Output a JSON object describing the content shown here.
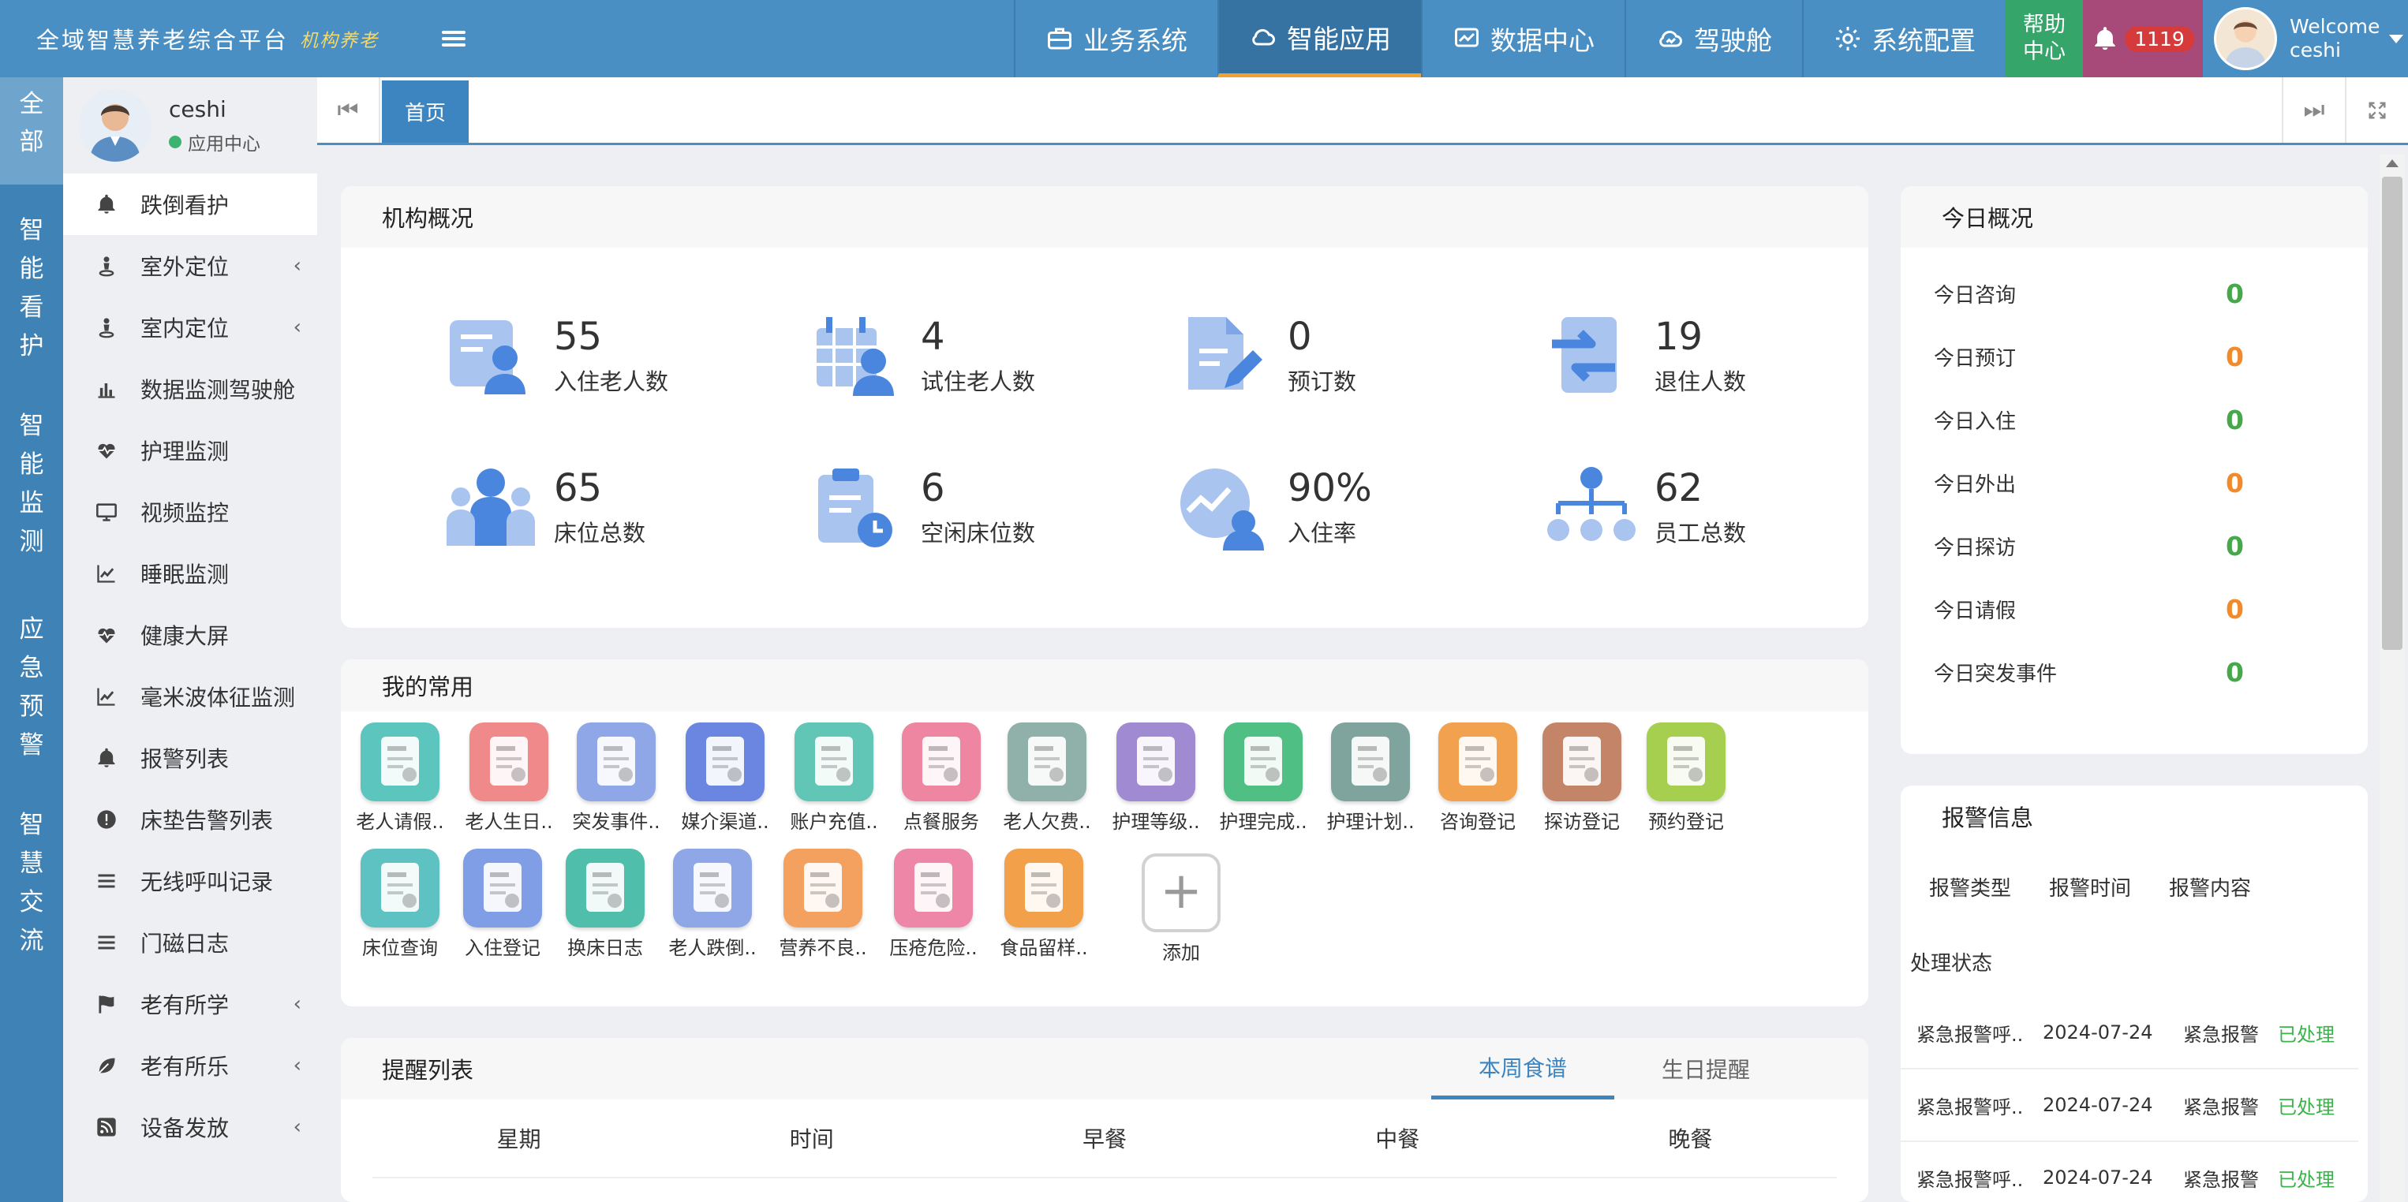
{
  "header": {
    "title": "全域智慧养老综合平台",
    "subtitle": "机构养老",
    "nav": [
      {
        "label": "业务系统",
        "icon": "briefcase-icon"
      },
      {
        "label": "智能应用",
        "icon": "cloud-icon"
      },
      {
        "label": "数据中心",
        "icon": "monitor-chart-icon"
      },
      {
        "label": "驾驶舱",
        "icon": "cloud-icon"
      },
      {
        "label": "系统配置",
        "icon": "gear-icon"
      }
    ],
    "active_nav": "智能应用",
    "help_label": "帮助中心",
    "notifications": "1119",
    "welcome": "Welcome",
    "username": "ceshi"
  },
  "categories": [
    {
      "label": "全部"
    },
    {
      "label": "智能看护"
    },
    {
      "label": "智能监测"
    },
    {
      "label": "应急预警"
    },
    {
      "label": "智慧交流"
    }
  ],
  "sidebar": {
    "user_name": "ceshi",
    "user_role": "应用中心",
    "items": [
      {
        "label": "跌倒看护",
        "icon": "bell-icon"
      },
      {
        "label": "室外定位",
        "icon": "person-pin-icon",
        "has_children": true
      },
      {
        "label": "室内定位",
        "icon": "person-pin-icon",
        "has_children": true
      },
      {
        "label": "数据监测驾驶舱",
        "icon": "bar-chart-icon"
      },
      {
        "label": "护理监测",
        "icon": "heartbeat-icon"
      },
      {
        "label": "视频监控",
        "icon": "monitor-icon"
      },
      {
        "label": "睡眠监测",
        "icon": "line-chart-icon"
      },
      {
        "label": "健康大屏",
        "icon": "heartbeat-icon"
      },
      {
        "label": "毫米波体征监测",
        "icon": "line-chart-icon"
      },
      {
        "label": "报警列表",
        "icon": "bell-icon"
      },
      {
        "label": "床垫告警列表",
        "icon": "alert-circle-icon"
      },
      {
        "label": "无线呼叫记录",
        "icon": "list-icon"
      },
      {
        "label": "门磁日志",
        "icon": "list-icon"
      },
      {
        "label": "老有所学",
        "icon": "flag-icon",
        "has_children": true
      },
      {
        "label": "老有所乐",
        "icon": "leaf-icon",
        "has_children": true
      },
      {
        "label": "设备发放",
        "icon": "rss-icon",
        "has_children": true
      }
    ]
  },
  "tabs": {
    "home_label": "首页"
  },
  "overview": {
    "title": "机构概况",
    "stats": [
      {
        "value": "55",
        "label": "入住老人数",
        "icon": "resident-card-icon"
      },
      {
        "value": "4",
        "label": "试住老人数",
        "icon": "calendar-person-icon"
      },
      {
        "value": "0",
        "label": "预订数",
        "icon": "document-edit-icon"
      },
      {
        "value": "19",
        "label": "退住人数",
        "icon": "exchange-arrows-icon"
      },
      {
        "value": "65",
        "label": "床位总数",
        "icon": "group-icon"
      },
      {
        "value": "6",
        "label": "空闲床位数",
        "icon": "clipboard-clock-icon"
      },
      {
        "value": "90%",
        "label": "入住率",
        "icon": "trend-person-icon"
      },
      {
        "value": "62",
        "label": "员工总数",
        "icon": "org-chart-icon"
      }
    ]
  },
  "today": {
    "title": "今日概况",
    "rows": [
      {
        "label": "今日咨询",
        "value": "0",
        "color": "#46a84a"
      },
      {
        "label": "今日预订",
        "value": "0",
        "color": "#f08a2a"
      },
      {
        "label": "今日入住",
        "value": "0",
        "color": "#46a84a"
      },
      {
        "label": "今日外出",
        "value": "0",
        "color": "#f08a2a"
      },
      {
        "label": "今日探访",
        "value": "0",
        "color": "#46a84a"
      },
      {
        "label": "今日请假",
        "value": "0",
        "color": "#f08a2a"
      },
      {
        "label": "今日突发事件",
        "value": "0",
        "color": "#46a84a"
      }
    ]
  },
  "favorites": {
    "title": "我的常用",
    "items": [
      {
        "label": "老人请假..",
        "color": "#5cc6be",
        "icon": "leave-icon"
      },
      {
        "label": "老人生日..",
        "color": "#f08a8a",
        "icon": "birthday-cake-icon"
      },
      {
        "label": "突发事件..",
        "color": "#8fa7e6",
        "icon": "event-form-icon"
      },
      {
        "label": "媒介渠道..",
        "color": "#6b86e0",
        "icon": "growth-chart-icon"
      },
      {
        "label": "账户充值..",
        "color": "#62c6b6",
        "icon": "person-money-icon"
      },
      {
        "label": "点餐服务",
        "color": "#ee86a2",
        "icon": "dish-icon"
      },
      {
        "label": "老人欠费..",
        "color": "#8fb1aa",
        "icon": "bill-icon"
      },
      {
        "label": "护理等级..",
        "color": "#a08ad2",
        "icon": "nurse-icon"
      },
      {
        "label": "护理完成..",
        "color": "#4fbf84",
        "icon": "checklist-icon"
      },
      {
        "label": "护理计划..",
        "color": "#7fa39d",
        "icon": "plan-clock-icon"
      },
      {
        "label": "咨询登记",
        "color": "#f2a24e",
        "icon": "id-card-icon"
      },
      {
        "label": "探访登记",
        "color": "#c48468",
        "icon": "visit-doc-icon"
      },
      {
        "label": "预约登记",
        "color": "#a7cf4f",
        "icon": "reserve-icon"
      },
      {
        "label": "床位查询",
        "color": "#5fc2c2",
        "icon": "bed-search-icon"
      },
      {
        "label": "入住登记",
        "color": "#7f9ee6",
        "icon": "checkin-card-icon"
      },
      {
        "label": "换床日志",
        "color": "#4fbeab",
        "icon": "bed-swap-icon"
      },
      {
        "label": "老人跌倒..",
        "color": "#8fa7e6",
        "icon": "fall-doc-icon"
      },
      {
        "label": "营养不良..",
        "color": "#f4a05e",
        "icon": "nutrition-icon"
      },
      {
        "label": "压疮危险..",
        "color": "#ee86a8",
        "icon": "risk-clipboard-icon"
      },
      {
        "label": "食品留样..",
        "color": "#f2a04a",
        "icon": "food-sample-icon"
      }
    ],
    "add_label": "添加"
  },
  "alarm": {
    "title": "报警信息",
    "columns": [
      "报警类型",
      "报警时间",
      "报警内容"
    ],
    "status_header": "处理状态",
    "rows": [
      {
        "type": "紧急报警呼..",
        "time": "2024-07-24",
        "content": "紧急报警",
        "status": "已处理"
      },
      {
        "type": "紧急报警呼..",
        "time": "2024-07-24",
        "content": "紧急报警",
        "status": "已处理"
      },
      {
        "type": "紧急报警呼..",
        "time": "2024-07-24",
        "content": "紧急报警",
        "status": "已处理"
      }
    ]
  },
  "reminders": {
    "title": "提醒列表",
    "tabs": [
      "本周食谱",
      "生日提醒"
    ],
    "columns": [
      "星期",
      "时间",
      "早餐",
      "中餐",
      "晚餐"
    ]
  }
}
